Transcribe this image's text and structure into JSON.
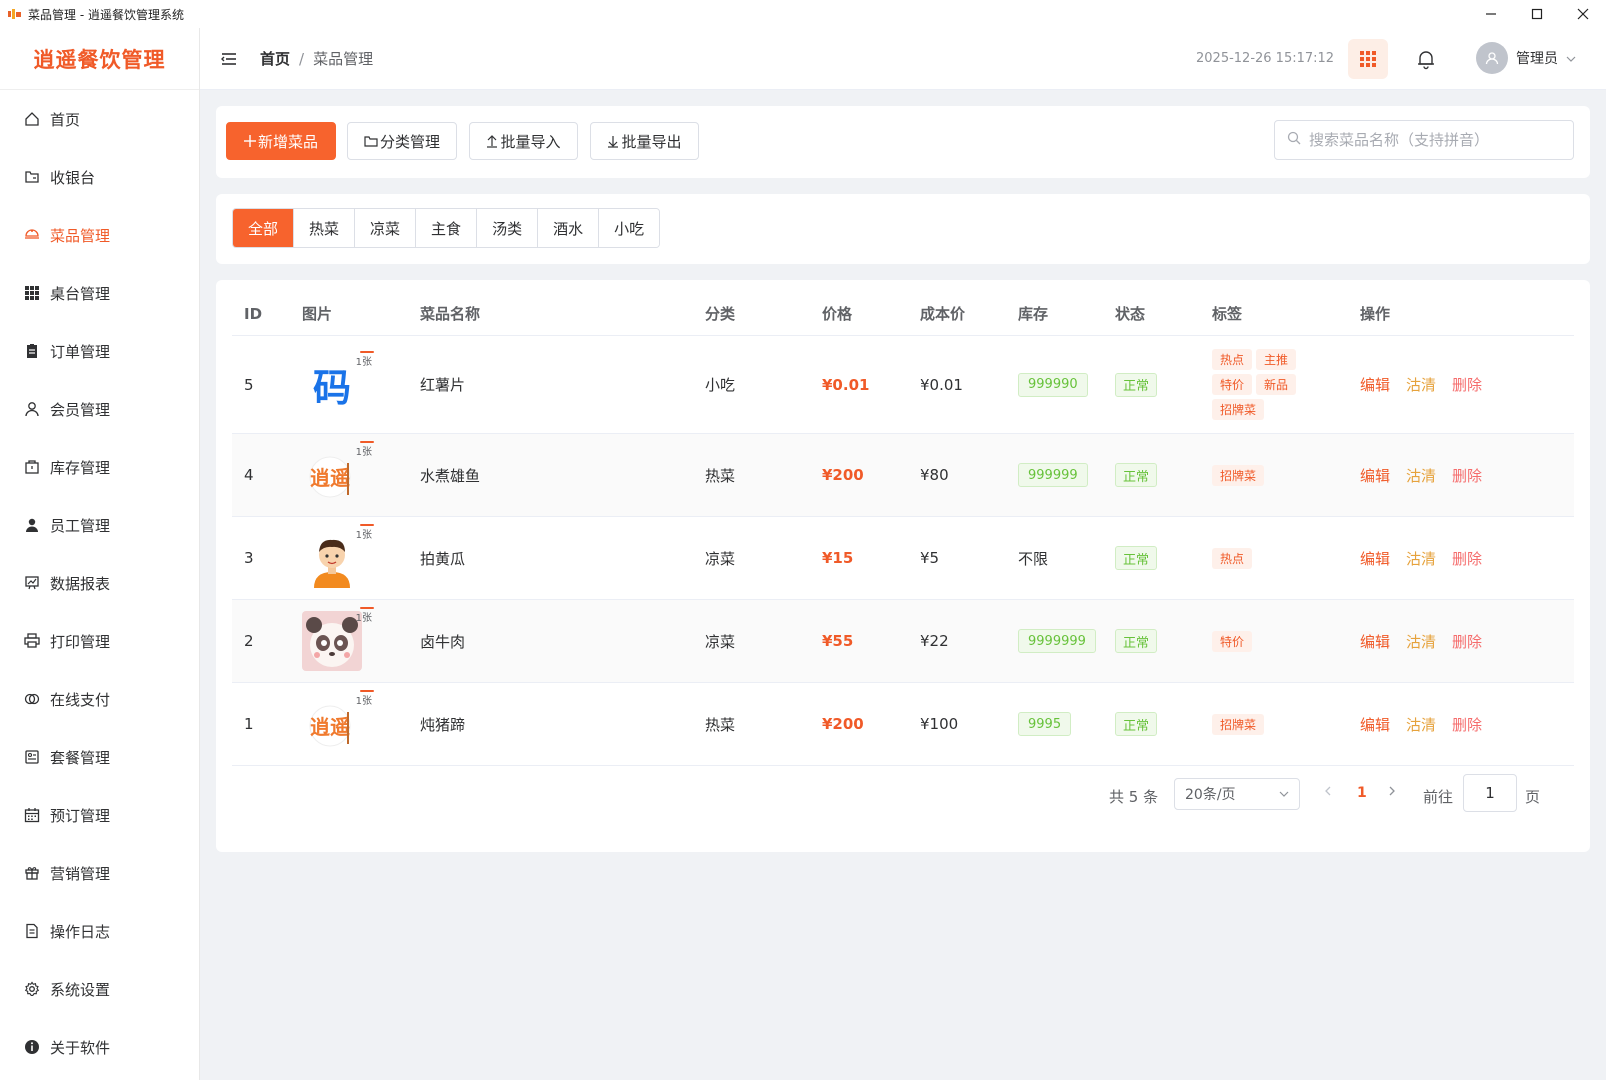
{
  "window": {
    "title": "菜品管理 - 逍遥餐饮管理系统",
    "controls": [
      "—",
      "☐",
      "✕"
    ]
  },
  "sidebar": {
    "logo": "逍遥餐饮管理",
    "items": [
      {
        "label": "首页",
        "icon": "home-icon"
      },
      {
        "label": "收银台",
        "icon": "cashier-icon"
      },
      {
        "label": "菜品管理",
        "icon": "dish-icon",
        "active": true
      },
      {
        "label": "桌台管理",
        "icon": "grid-icon"
      },
      {
        "label": "订单管理",
        "icon": "clipboard-icon"
      },
      {
        "label": "会员管理",
        "icon": "user-icon"
      },
      {
        "label": "库存管理",
        "icon": "box-icon"
      },
      {
        "label": "员工管理",
        "icon": "staff-icon"
      },
      {
        "label": "数据报表",
        "icon": "chart-icon"
      },
      {
        "label": "打印管理",
        "icon": "printer-icon"
      },
      {
        "label": "在线支付",
        "icon": "payment-icon"
      },
      {
        "label": "套餐管理",
        "icon": "package-icon"
      },
      {
        "label": "预订管理",
        "icon": "calendar-icon"
      },
      {
        "label": "营销管理",
        "icon": "gift-icon"
      },
      {
        "label": "操作日志",
        "icon": "document-icon"
      },
      {
        "label": "系统设置",
        "icon": "gear-icon"
      },
      {
        "label": "关于软件",
        "icon": "info-icon"
      }
    ]
  },
  "header": {
    "breadcrumb_home": "首页",
    "breadcrumb_sep": "/",
    "breadcrumb_current": "菜品管理",
    "datetime": "2025-12-26 15:17:12",
    "user_name": "管理员"
  },
  "toolbar": {
    "add": "新增菜品",
    "category": "分类管理",
    "import": "批量导入",
    "export": "批量导出",
    "search_placeholder": "搜索菜品名称（支持拼音）"
  },
  "categories": [
    "全部",
    "热菜",
    "凉菜",
    "主食",
    "汤类",
    "酒水",
    "小吃"
  ],
  "table": {
    "headers": {
      "id": "ID",
      "image": "图片",
      "name": "菜品名称",
      "category": "分类",
      "price": "价格",
      "cost": "成本价",
      "stock": "库存",
      "status": "状态",
      "tags": "标签",
      "actions": "操作"
    },
    "rows": [
      {
        "id": "5",
        "img_count": "1张",
        "name": "红薯片",
        "category": "小吃",
        "price": "¥0.01",
        "cost": "¥0.01",
        "stock": "999990",
        "status": "正常",
        "tags": [
          "热点",
          "主推",
          "特价",
          "新品",
          "招牌菜"
        ]
      },
      {
        "id": "4",
        "img_count": "1张",
        "name": "水煮雄鱼",
        "category": "热菜",
        "price": "¥200",
        "cost": "¥80",
        "stock": "999999",
        "status": "正常",
        "tags": [
          "招牌菜"
        ]
      },
      {
        "id": "3",
        "img_count": "1张",
        "name": "拍黄瓜",
        "category": "凉菜",
        "price": "¥15",
        "cost": "¥5",
        "stock": "不限",
        "status": "正常",
        "tags": [
          "热点"
        ]
      },
      {
        "id": "2",
        "img_count": "1张",
        "name": "卤牛肉",
        "category": "凉菜",
        "price": "¥55",
        "cost": "¥22",
        "stock": "9999999",
        "status": "正常",
        "tags": [
          "特价"
        ]
      },
      {
        "id": "1",
        "img_count": "1张",
        "name": "炖猪蹄",
        "category": "热菜",
        "price": "¥200",
        "cost": "¥100",
        "stock": "9995",
        "status": "正常",
        "tags": [
          "招牌菜"
        ]
      }
    ],
    "actions": {
      "edit": "编辑",
      "clear": "沽清",
      "delete": "删除"
    }
  },
  "logo_text": {
    "code": "码",
    "brand": "逍遥"
  },
  "pagination": {
    "total": "共 5 条",
    "page_size": "20条/页",
    "current": "1",
    "goto_label": "前往",
    "goto_value": "1",
    "page_suffix": "页"
  },
  "colors": {
    "accent": "#f7632d",
    "success": "#67c23a",
    "warning": "#e6a23c",
    "danger": "#f56c6c"
  }
}
